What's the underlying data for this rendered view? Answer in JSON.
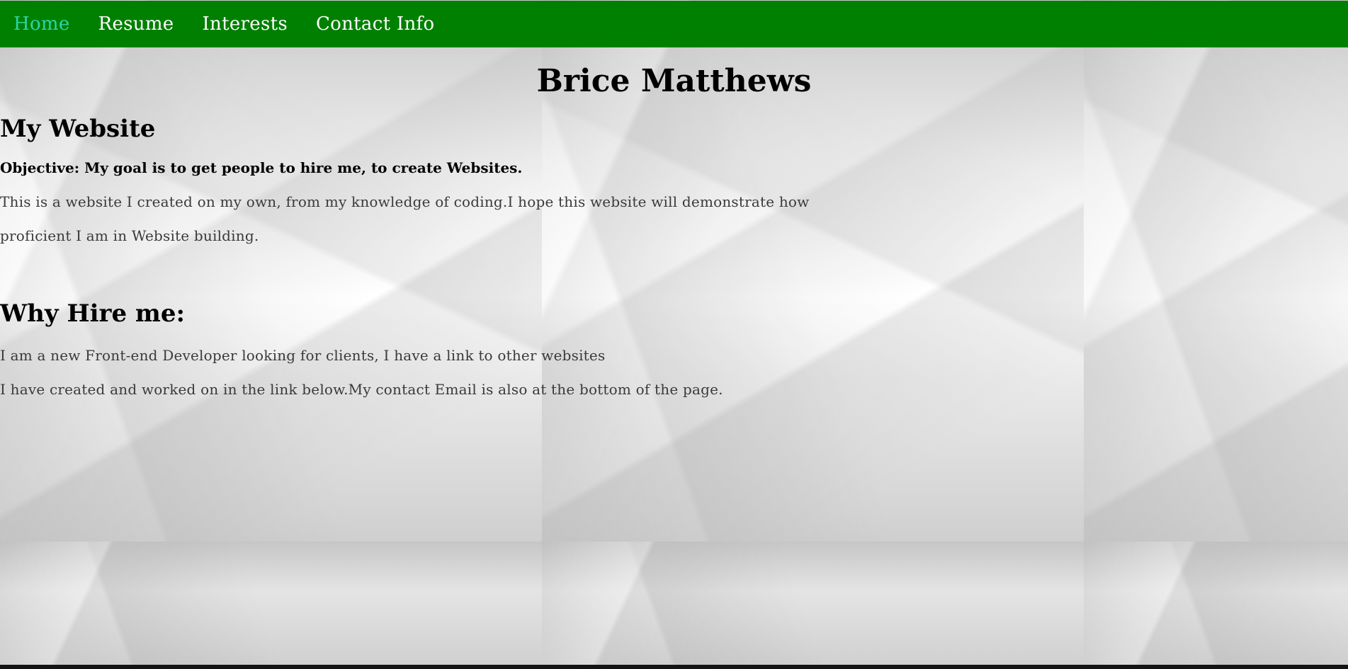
{
  "nav": {
    "items": [
      {
        "label": "Home",
        "active": true
      },
      {
        "label": "Resume",
        "active": false
      },
      {
        "label": "Interests",
        "active": false
      },
      {
        "label": "Contact Info",
        "active": false
      }
    ],
    "background_color": "#008000",
    "active_color": "#2fd4a8"
  },
  "header": {
    "title": "Brice Matthews"
  },
  "section_website": {
    "heading": "My Website",
    "objective": "Objective: My goal is to get people to hire me, to create Websites.",
    "body": "This is a website I created on my own, from my knowledge of coding.I hope this website will demonstrate how proficient I am in Website building."
  },
  "section_hire": {
    "heading": "Why Hire me:",
    "body_line1": "I am a new Front-end Developer looking for clients, I have a link to other websites",
    "body_line2": "I have created and worked on in the link below.My contact Email is also at the bottom of the page."
  }
}
